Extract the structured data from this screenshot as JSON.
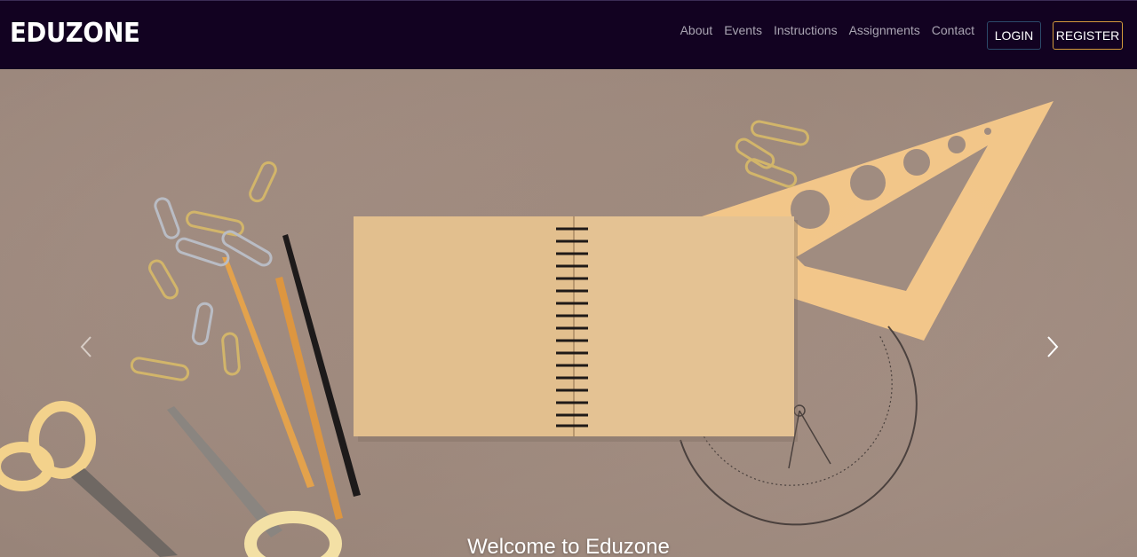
{
  "brand": {
    "name": "EDUZONE"
  },
  "nav": {
    "links": [
      {
        "label": "About"
      },
      {
        "label": "Events"
      },
      {
        "label": "Instructions"
      },
      {
        "label": "Assignments"
      },
      {
        "label": "Contact"
      }
    ],
    "login_label": "LOGIN",
    "register_label": "REGISTER"
  },
  "hero": {
    "caption": "Welcome to Eduzone",
    "prev_icon": "chevron-left-icon",
    "next_icon": "chevron-right-icon"
  },
  "colors": {
    "navbar_bg": "#120221",
    "nav_link": "#a9a4b2",
    "register_border": "#d39a3c",
    "login_border": "#2c4a6a",
    "hero_bg": "#a08c80"
  }
}
